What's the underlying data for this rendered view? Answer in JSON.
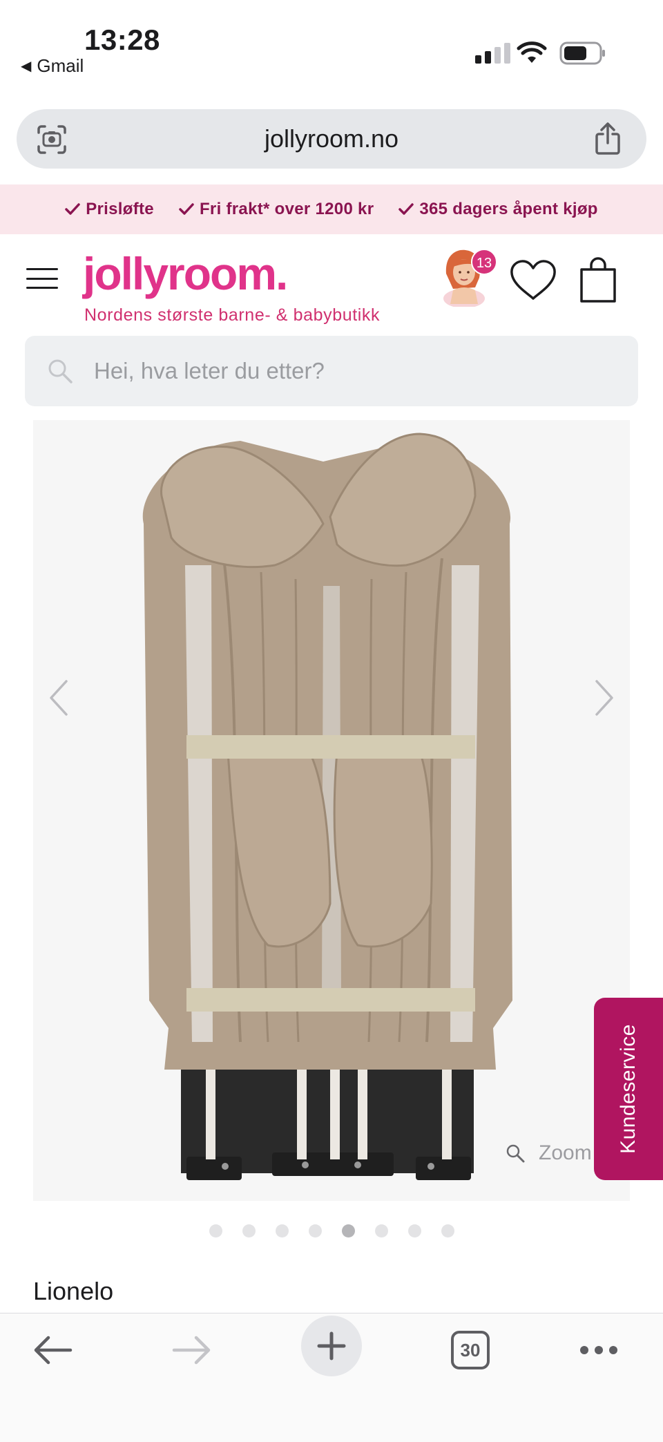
{
  "status_bar": {
    "time": "13:28",
    "back_app": "Gmail",
    "signal_bars": 4,
    "signal_active_bars": 2
  },
  "browser": {
    "url": "jollyroom.no",
    "tabs_count": "30"
  },
  "usp_bar": {
    "items": [
      "Prisløfte",
      "Fri frakt* over 1200 kr",
      "365 dagers åpent kjøp"
    ]
  },
  "header": {
    "logo_text": "jollyroom.",
    "tagline": "Nordens største barne- & babybutikk",
    "avatar_badge_count": "13"
  },
  "search": {
    "placeholder": "Hei, hva leter du etter?"
  },
  "gallery": {
    "zoom_label": "Zoom",
    "total_images": 8,
    "active_image_index": 4
  },
  "product": {
    "brand": "Lionelo"
  },
  "support": {
    "label": "Kundeservice"
  },
  "colors": {
    "brand_pink": "#e0338a",
    "usp_bg": "#fae6eb",
    "usp_text": "#8a1450",
    "kundeservice_bg": "#b01560",
    "fabric": "#b3a08b"
  },
  "icons": {
    "url_scan": "camera-scan-icon",
    "share": "share-icon",
    "check": "check-icon",
    "menu": "hamburger-icon",
    "wishlist": "heart-icon",
    "cart": "shopping-bag-icon",
    "search": "search-icon",
    "prev": "chevron-left-icon",
    "next": "chevron-right-icon",
    "back": "arrow-left-icon",
    "forward": "arrow-right-icon",
    "new_tab": "plus-icon",
    "more": "more-dots-icon"
  }
}
